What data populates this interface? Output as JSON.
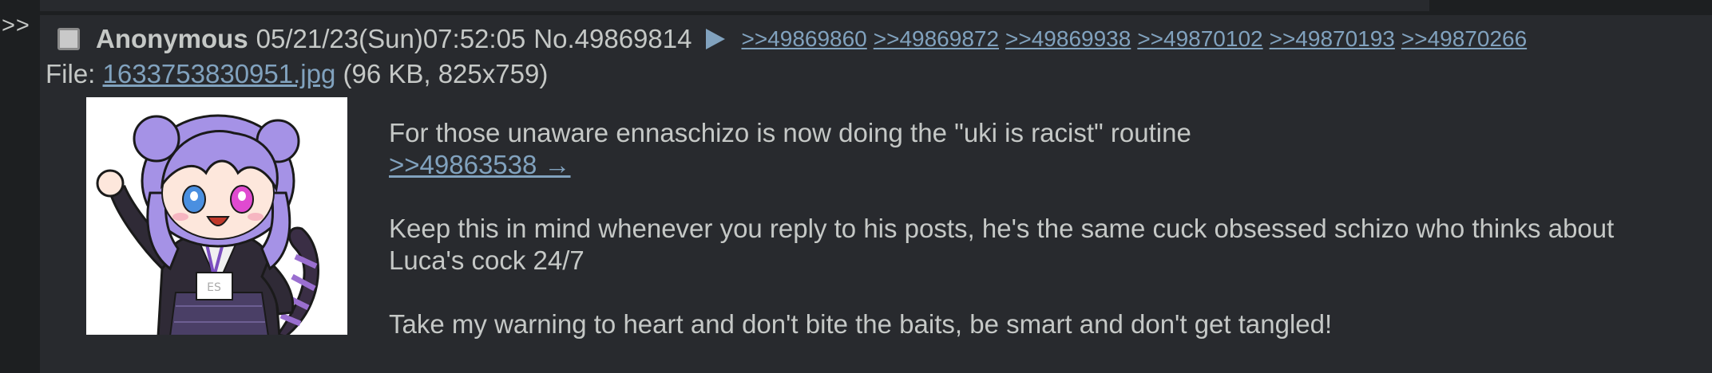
{
  "side": {
    "arrows": ">>"
  },
  "post": {
    "name": "Anonymous",
    "datetime": "05/21/23(Sun)07:52:05",
    "number": "No.49869814",
    "backlinks": [
      ">>49869860",
      ">>49869872",
      ">>49869938",
      ">>49870102",
      ">>49870193",
      ">>49870266"
    ],
    "file": {
      "prefix": "File:",
      "name": "1633753830951.jpg",
      "meta": "(96 KB, 825x759)"
    },
    "message": {
      "line1": "For those unaware ennaschizo is now doing the \"uki is racist\" routine",
      "quote": ">>49863538 →",
      "line2": "Keep this in mind whenever you reply to his posts, he's the same cuck obsessed schizo who thinks about Luca's cock 24/7",
      "line3": "Take my warning to heart and don't bite the baits, be smart and don't get tangled!"
    }
  },
  "colors": {
    "background": "#1d1f21",
    "post_background": "#282a2e",
    "text": "#c5c8c6",
    "link": "#81a2be"
  },
  "icons": {
    "post_menu": "triangle-right-icon",
    "select": "checkbox-icon"
  }
}
